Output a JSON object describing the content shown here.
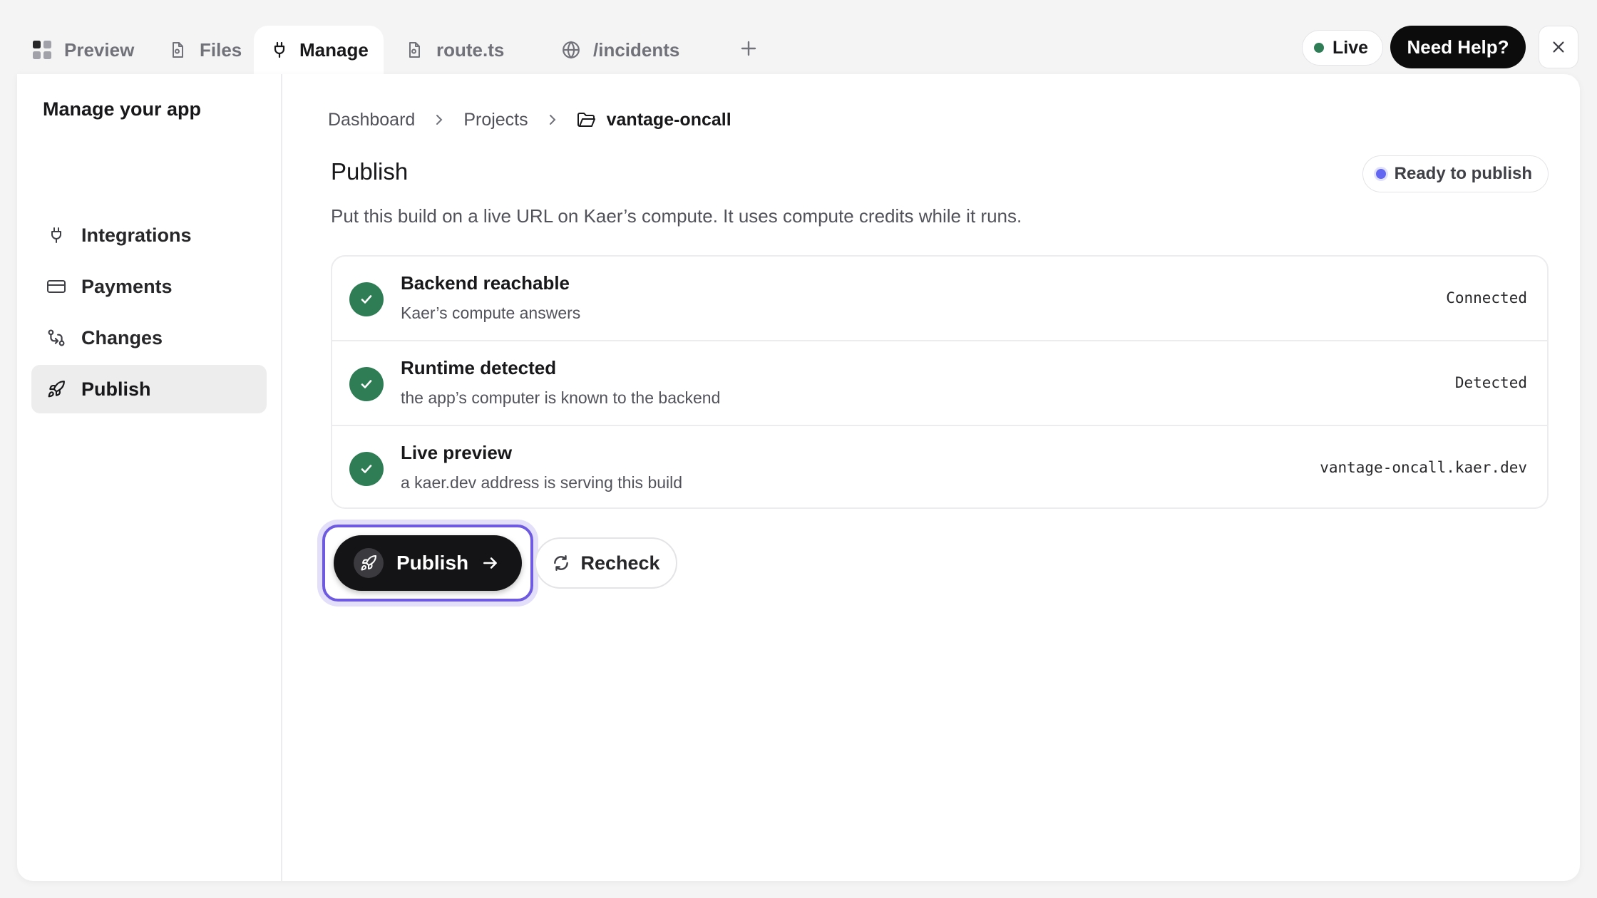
{
  "tabs": [
    {
      "label": "Preview",
      "icon": "grid-icon"
    },
    {
      "label": "Files",
      "icon": "file-icon"
    },
    {
      "label": "Manage",
      "icon": "plug-icon"
    },
    {
      "label": "route.ts",
      "icon": "file-icon"
    },
    {
      "label": "/incidents",
      "icon": "globe-icon"
    }
  ],
  "active_tab": "Manage",
  "header": {
    "live_label": "Live",
    "help_label": "Need Help?"
  },
  "sidebar": {
    "title": "Manage your app",
    "items": [
      {
        "label": "Integrations",
        "icon": "plug-icon"
      },
      {
        "label": "Payments",
        "icon": "credit-card-icon"
      },
      {
        "label": "Changes",
        "icon": "git-compare-icon"
      },
      {
        "label": "Publish",
        "icon": "rocket-icon"
      }
    ],
    "active": "Publish"
  },
  "breadcrumb": {
    "items": [
      "Dashboard",
      "Projects"
    ],
    "current": "vantage-oncall"
  },
  "main": {
    "title": "Publish",
    "status": "Ready to publish",
    "description": "Put this build on a live URL on Kaer’s compute. It uses compute credits while it runs.",
    "checks": [
      {
        "title": "Backend reachable",
        "subtitle": "Kaer’s compute answers",
        "status": "Connected"
      },
      {
        "title": "Runtime detected",
        "subtitle": "the app’s computer is known to the backend",
        "status": "Detected"
      },
      {
        "title": "Live preview",
        "subtitle": "a kaer.dev address is serving this build",
        "status": "vantage-oncall.kaer.dev"
      }
    ],
    "publish_label": "Publish",
    "recheck_label": "Recheck"
  },
  "colors": {
    "accent": "#6d5ae0",
    "success": "#2e7d55",
    "status_dot": "#6366f1",
    "live_dot": "#2f7d57",
    "dark_button": "#141416"
  }
}
